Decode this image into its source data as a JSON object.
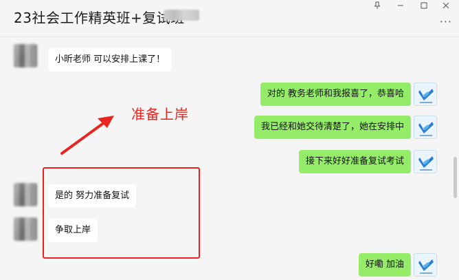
{
  "window": {
    "title": "23社会工作精英班+复试班",
    "pin_icon": "pin-icon",
    "minimize_icon": "minimize-icon",
    "maximize_icon": "maximize-icon",
    "close_icon": "close-icon",
    "more_label": "···"
  },
  "messages": [
    {
      "side": "left",
      "text": "小昕老师 可以安排上课了！"
    },
    {
      "side": "right",
      "text": "对的 教务老师和我报喜了，恭喜哈"
    },
    {
      "side": "right",
      "text": "我已经和她交待清楚了，她在安排中"
    },
    {
      "side": "right",
      "text": "接下来好好准备复试考试"
    },
    {
      "side": "left",
      "text": "是的 努力准备复试"
    },
    {
      "side": "left",
      "text": "争取上岸"
    },
    {
      "side": "right",
      "text": "好嘞 加油"
    }
  ],
  "annotation": {
    "text": "准备上岸",
    "color": "#e8261f"
  },
  "colors": {
    "bubble_right": "#95ec69",
    "bubble_left": "#ffffff",
    "background": "#f5f5f5"
  }
}
